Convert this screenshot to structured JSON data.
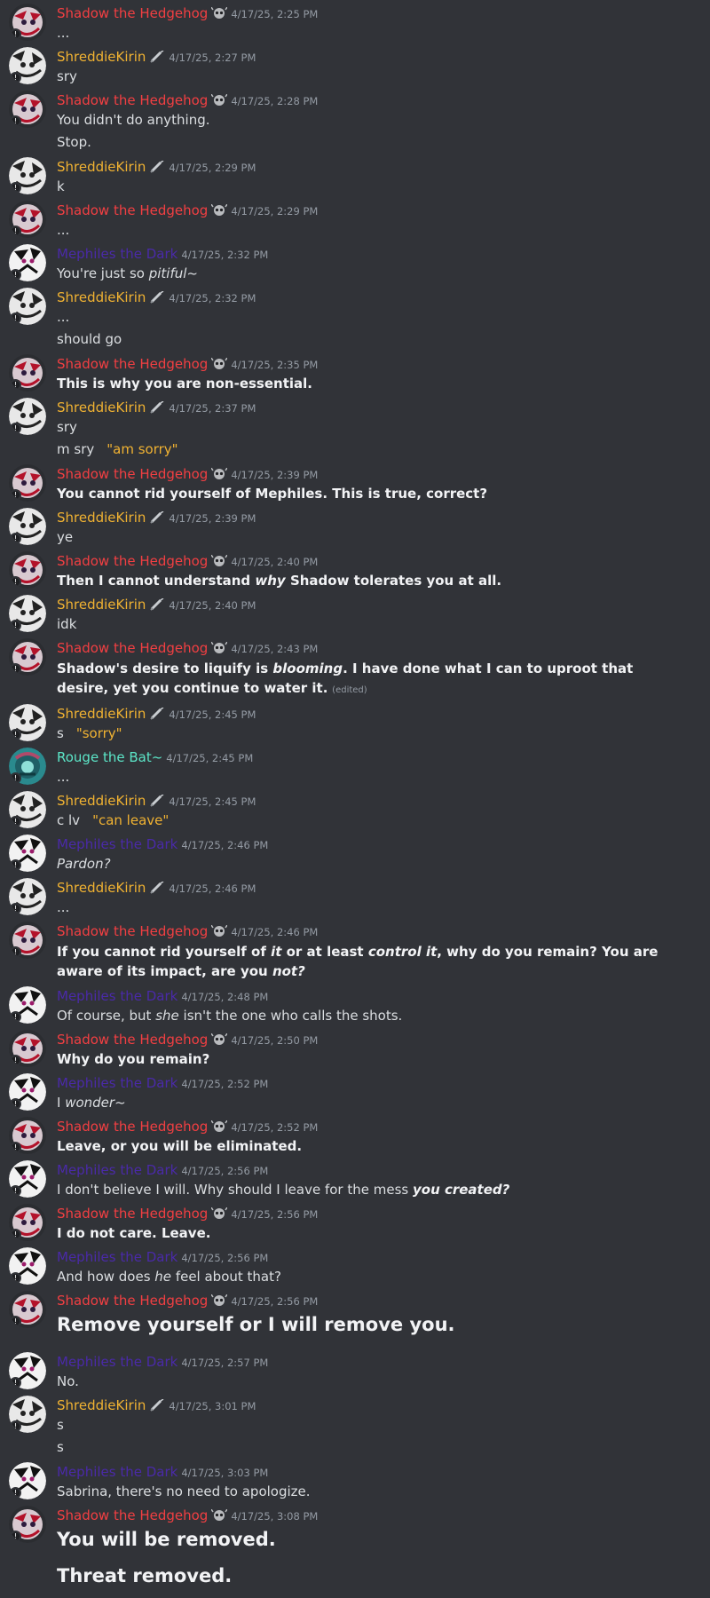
{
  "users": {
    "shadow": "Shadow the Hedgehog",
    "shreddie": "ShreddieKirin",
    "mephiles": "Mephiles the Dark",
    "rouge": "Rouge the Bat~"
  },
  "colors": {
    "shadow": "#f23f42",
    "shreddie": "#f0b232",
    "mephiles": "#4a2aa8",
    "rouge": "#5ce6c8",
    "background": "#313338"
  },
  "icons": {
    "shadow_tag": "skull-emblem-icon",
    "shreddie_tag": "syringe-icon",
    "avatar_badge": "status-badge-icon"
  },
  "messages": [
    {
      "ts": "4/17/25, 2:25 PM",
      "lines": [
        "..."
      ]
    },
    {
      "ts": "4/17/25, 2:27 PM",
      "lines": [
        "sry"
      ]
    },
    {
      "ts": "4/17/25, 2:28 PM",
      "lines": [
        "You didn't do anything.",
        "Stop."
      ]
    },
    {
      "ts": "4/17/25, 2:29 PM",
      "lines": [
        "k"
      ]
    },
    {
      "ts": "4/17/25, 2:29 PM",
      "lines": [
        "..."
      ]
    },
    {
      "ts": "4/17/25, 2:32 PM",
      "lines": [
        "You're just so ",
        "pitiful",
        "~"
      ]
    },
    {
      "ts": "4/17/25, 2:32 PM",
      "lines": [
        "...",
        "should go"
      ]
    },
    {
      "ts": "4/17/25, 2:35 PM",
      "lines": [
        "This is why you are non-essential."
      ]
    },
    {
      "ts": "4/17/25, 2:37 PM",
      "lines": [
        "sry",
        "m sry",
        "\"am sorry\""
      ]
    },
    {
      "ts": "4/17/25, 2:39 PM",
      "lines": [
        "You cannot rid yourself of Mephiles. This is true, correct?"
      ]
    },
    {
      "ts": "4/17/25, 2:39 PM",
      "lines": [
        "ye"
      ]
    },
    {
      "ts": "4/17/25, 2:40 PM",
      "lines": [
        "Then I cannot understand ",
        "why",
        " Shadow tolerates you at all."
      ]
    },
    {
      "ts": "4/17/25, 2:40 PM",
      "lines": [
        "idk"
      ]
    },
    {
      "ts": "4/17/25, 2:43 PM",
      "lines": [
        "Shadow's desire to liquify is ",
        "blooming",
        ". I have done what I can to uproot that desire, yet you continue to water it.",
        "(edited)"
      ]
    },
    {
      "ts": "4/17/25, 2:45 PM",
      "lines": [
        "s",
        "\"sorry\""
      ]
    },
    {
      "ts": "4/17/25, 2:45 PM",
      "lines": [
        "..."
      ]
    },
    {
      "ts": "4/17/25, 2:45 PM",
      "lines": [
        "c lv",
        "\"can leave\""
      ]
    },
    {
      "ts": "4/17/25, 2:46 PM",
      "lines": [
        "Pardon?"
      ]
    },
    {
      "ts": "4/17/25, 2:46 PM",
      "lines": [
        "..."
      ]
    },
    {
      "ts": "4/17/25, 2:46 PM",
      "lines": [
        "If you cannot rid yourself of ",
        "it",
        " or at least ",
        "control it",
        ", why do you remain? You are aware of its impact, are you ",
        "not?"
      ]
    },
    {
      "ts": "4/17/25, 2:48 PM",
      "lines": [
        "Of course, but ",
        "she",
        " isn't the one who calls the shots."
      ]
    },
    {
      "ts": "4/17/25, 2:50 PM",
      "lines": [
        "Why do you remain?"
      ]
    },
    {
      "ts": "4/17/25, 2:52 PM",
      "lines": [
        "I ",
        "wonder",
        "~"
      ]
    },
    {
      "ts": "4/17/25, 2:52 PM",
      "lines": [
        "Leave, or you will be eliminated."
      ]
    },
    {
      "ts": "4/17/25, 2:56 PM",
      "lines": [
        "I don't believe I will. Why should I leave for the mess ",
        "you created?"
      ]
    },
    {
      "ts": "4/17/25, 2:56 PM",
      "lines": [
        "I do not care. Leave."
      ]
    },
    {
      "ts": "4/17/25, 2:56 PM",
      "lines": [
        "And how does ",
        "he",
        " feel about that?"
      ]
    },
    {
      "ts": "4/17/25, 2:56 PM",
      "lines": [
        "Remove yourself or I will remove you."
      ]
    },
    {
      "ts": "4/17/25, 2:57 PM",
      "lines": [
        "No."
      ]
    },
    {
      "ts": "4/17/25, 3:01 PM",
      "lines": [
        "s",
        "s"
      ]
    },
    {
      "ts": "4/17/25, 3:03 PM",
      "lines": [
        "Sabrina, there's no need to apologize."
      ]
    },
    {
      "ts": "4/17/25, 3:08 PM",
      "lines": [
        "You will be removed.",
        "Threat removed."
      ]
    }
  ]
}
